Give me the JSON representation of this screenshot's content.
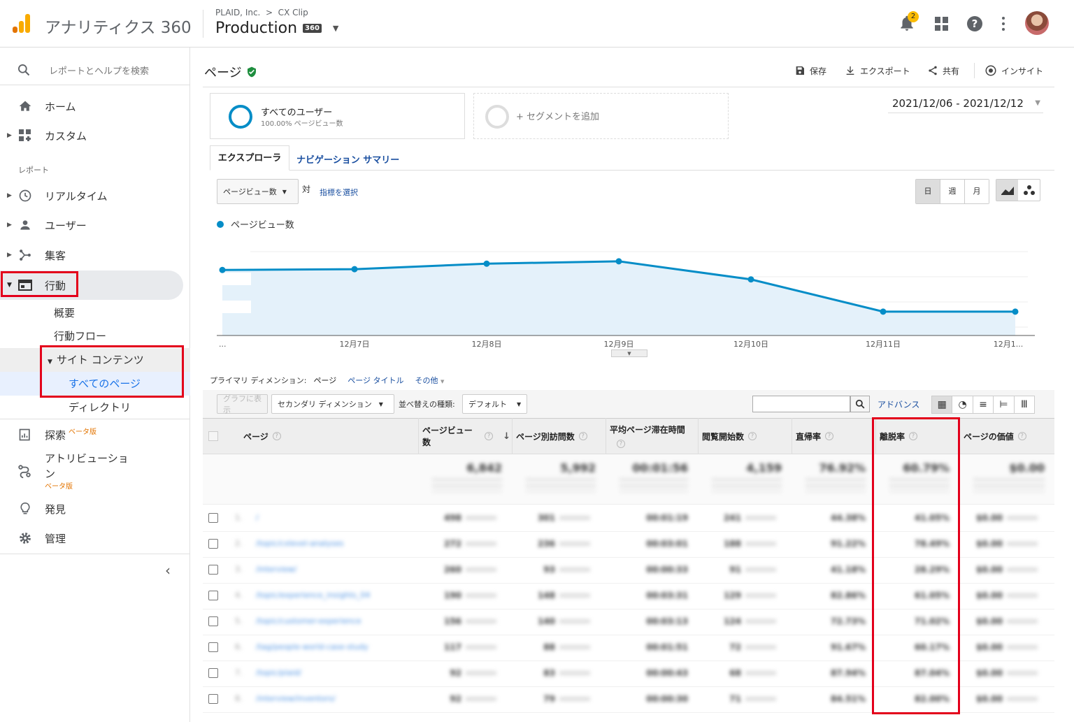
{
  "header": {
    "product": "アナリティクス 360",
    "account_path": "PLAID, Inc.  >  CX Clip",
    "property": "Production",
    "badge": "360",
    "notification_count": "2"
  },
  "sidebar": {
    "search_placeholder": "レポートとヘルプを検索",
    "home": "ホーム",
    "custom": "カスタム",
    "reports_section": "レポート",
    "realtime": "リアルタイム",
    "users": "ユーザー",
    "acquisition": "集客",
    "behavior": "行動",
    "overview": "概要",
    "behavior_flow": "行動フロー",
    "site_content": "サイト コンテンツ",
    "all_pages": "すべてのページ",
    "directory": "ディレクトリ",
    "explore": "探索",
    "explore_beta": "ベータ版",
    "attribution_1": "アトリビューショ",
    "attribution_2": "ン",
    "attribution_beta": "ベータ版",
    "discover": "発見",
    "admin": "管理"
  },
  "page": {
    "title": "ページ",
    "save": "保存",
    "export": "エクスポート",
    "share": "共有",
    "insight": "インサイト",
    "date_range": "2021/12/06 - 2021/12/12"
  },
  "segments": {
    "all_users": "すべてのユーザー",
    "all_users_sub": "100.00% ページビュー数",
    "add_segment": "+ セグメントを追加"
  },
  "tabs": {
    "explorer": "エクスプローラ",
    "nav_summary": "ナビゲーション サマリー"
  },
  "chart_controls": {
    "metric": "ページビュー数",
    "vs": "対",
    "select_metric": "指標を選択",
    "day": "日",
    "week": "週",
    "month": "月"
  },
  "chart_data": {
    "type": "line",
    "series": [
      {
        "name": "ページビュー数",
        "color": "#058dc7",
        "values": [
          0.78,
          0.79,
          0.86,
          0.89,
          0.66,
          0.25,
          0.25
        ]
      }
    ],
    "x": [
      "...",
      "12月7日",
      "12月8日",
      "12月9日",
      "12月10日",
      "12月11日",
      "12月1..."
    ]
  },
  "dimensions": {
    "label": "プライマリ ディメンション:",
    "page": "ページ",
    "page_title": "ページ タイトル",
    "other": "その他"
  },
  "table_controls": {
    "plot": "グラフに表示",
    "secondary": "セカンダリ ディメンション",
    "sort_label": "並べ替えの種類:",
    "sort_value": "デフォルト",
    "advanced": "アドバンス"
  },
  "table": {
    "columns": [
      "ページ",
      "ページビュー数",
      "ページ別訪問数",
      "平均ページ滞在時間",
      "閲覧開始数",
      "直帰率",
      "離脱率",
      "ページの価値"
    ],
    "totals": [
      "6,842",
      "5,992",
      "00:01:56",
      "4,159",
      "76.92%",
      "60.79%",
      "$0.00"
    ],
    "rows": [
      [
        "1.",
        "/",
        "498",
        "301",
        "00:01:19",
        "241",
        "44.38%",
        "41.05%",
        "$0.00"
      ],
      [
        "2.",
        "/topic/cxlevel-analyses",
        "272",
        "236",
        "00:03:01",
        "188",
        "91.22%",
        "78.49%",
        "$0.00"
      ],
      [
        "3.",
        "/interview/",
        "260",
        "93",
        "00:00:33",
        "91",
        "41.18%",
        "28.29%",
        "$0.00"
      ],
      [
        "4.",
        "/topic/experience_insights_04",
        "190",
        "148",
        "00:03:31",
        "129",
        "82.86%",
        "61.05%",
        "$0.00"
      ],
      [
        "5.",
        "/topic/customer-experience",
        "156",
        "140",
        "00:03:13",
        "124",
        "72.73%",
        "71.02%",
        "$0.00"
      ],
      [
        "6.",
        "/tag/people-world-case-study",
        "117",
        "88",
        "00:01:51",
        "72",
        "91.67%",
        "60.17%",
        "$0.00"
      ],
      [
        "7.",
        "/topic/plaid/",
        "92",
        "83",
        "00:00:43",
        "68",
        "87.94%",
        "87.04%",
        "$0.00"
      ],
      [
        "8.",
        "/interview/inventors/",
        "92",
        "79",
        "00:00:30",
        "71",
        "84.51%",
        "82.00%",
        "$0.00"
      ]
    ]
  }
}
